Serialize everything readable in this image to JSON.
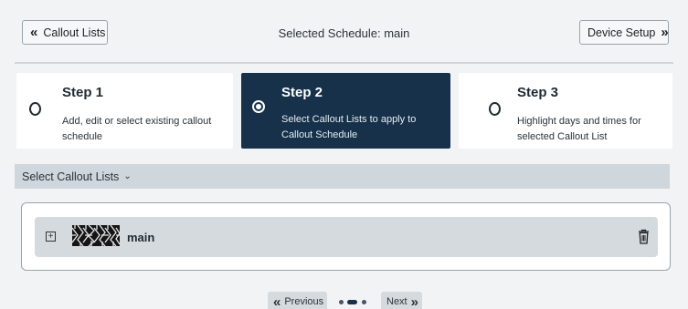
{
  "header": {
    "back_label": "Callout Lists",
    "title": "Selected Schedule: main",
    "forward_label": "Device Setup"
  },
  "steps": [
    {
      "title": "Step 1",
      "desc": "Add, edit or select existing callout schedule",
      "selected": false
    },
    {
      "title": "Step 2",
      "desc": "Select Callout Lists to apply to Callout Schedule",
      "selected": true
    },
    {
      "title": "Step 3",
      "desc": "Highlight days and times for selected Callout List",
      "selected": false
    }
  ],
  "select_bar": {
    "label": "Select Callout Lists"
  },
  "list": {
    "items": [
      {
        "label": "main"
      }
    ]
  },
  "pager": {
    "prev_label": "Previous",
    "next_label": "Next",
    "page_count": 3,
    "current_page": 2
  },
  "colors": {
    "accent": "#17314a",
    "background": "#f2f3f5",
    "bar": "#cfd6dc",
    "row": "#d5dade"
  },
  "icons": {
    "back": "double-chevron-left-icon",
    "forward": "double-chevron-right-icon",
    "dropdown": "chevron-down-icon",
    "expand": "plus-box-icon",
    "delete": "trash-icon",
    "thumbnail": "pattern-image"
  }
}
